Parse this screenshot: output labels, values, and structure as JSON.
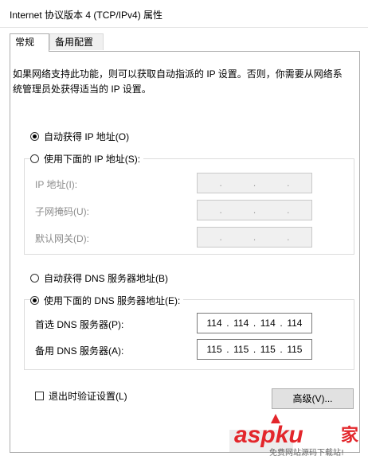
{
  "window": {
    "title": "Internet 协议版本 4 (TCP/IPv4) 属性"
  },
  "tabs": [
    {
      "label": "常规",
      "active": true
    },
    {
      "label": "备用配置",
      "active": false
    }
  ],
  "intro_text": "如果网络支持此功能，则可以获取自动指派的 IP 设置。否则，你需要从网络系统管理员处获得适当的 IP 设置。",
  "ip": {
    "auto_label": "自动获得 IP 地址(O)",
    "manual_label": "使用下面的 IP 地址(S):",
    "selected": "auto",
    "fields": [
      {
        "label": "IP 地址(I):",
        "value": [
          ".",
          ".",
          "."
        ]
      },
      {
        "label": "子网掩码(U):",
        "value": [
          ".",
          ".",
          "."
        ]
      },
      {
        "label": "默认网关(D):",
        "value": [
          ".",
          ".",
          "."
        ]
      }
    ]
  },
  "dns": {
    "auto_label": "自动获得 DNS 服务器地址(B)",
    "manual_label": "使用下面的 DNS 服务器地址(E):",
    "selected": "manual",
    "preferred": {
      "label": "首选 DNS 服务器(P):",
      "octets": [
        "114",
        "114",
        "114",
        "114"
      ]
    },
    "alternate": {
      "label": "备用 DNS 服务器(A):",
      "octets": [
        "115",
        "115",
        "115",
        "115"
      ]
    }
  },
  "validate_checkbox": {
    "label": "退出时验证设置(L)",
    "checked": false
  },
  "advanced_button": {
    "label": "高级(V)..."
  },
  "watermark": {
    "brand": "aspku",
    "suffix": "家",
    "caption": "免费网站源码下载站!"
  },
  "colors": {
    "accent_red": "#e3262b",
    "disabled_text": "#8c8c8c",
    "disabled_bg": "#f0f0f0"
  }
}
